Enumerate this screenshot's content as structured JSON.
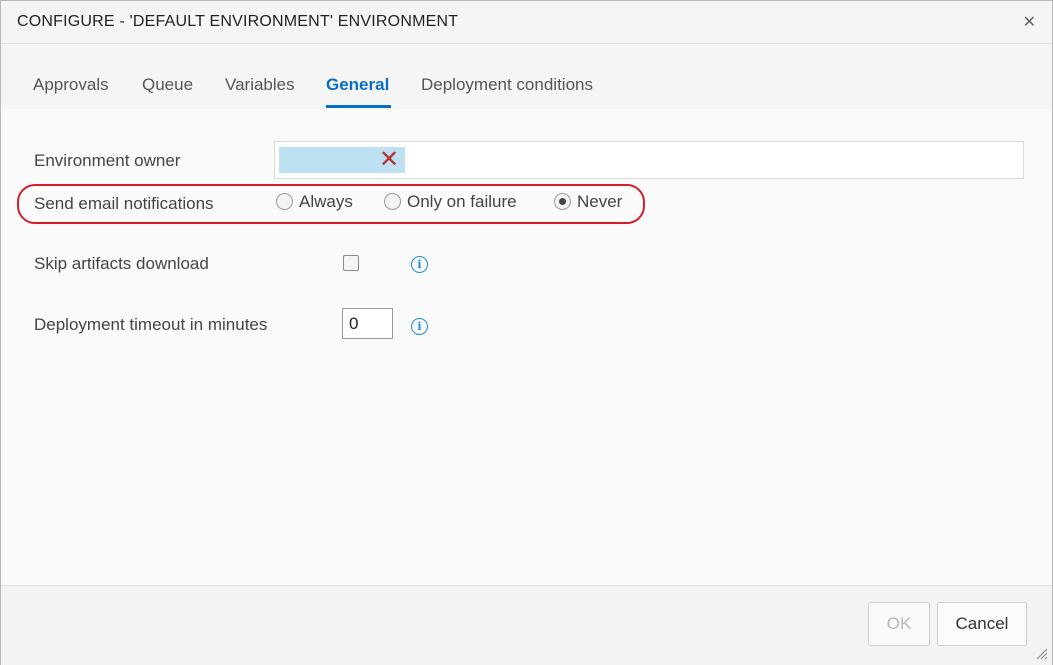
{
  "dialog": {
    "title": "CONFIGURE - 'DEFAULT ENVIRONMENT' ENVIRONMENT",
    "close_icon": "close-icon"
  },
  "tabs": [
    {
      "label": "Approvals",
      "active": false
    },
    {
      "label": "Queue",
      "active": false
    },
    {
      "label": "Variables",
      "active": false
    },
    {
      "label": "General",
      "active": true
    },
    {
      "label": "Deployment conditions",
      "active": false
    }
  ],
  "form": {
    "owner_label": "Environment owner",
    "email_label": "Send email notifications",
    "email_options": [
      {
        "label": "Always",
        "checked": false
      },
      {
        "label": "Only on failure",
        "checked": false
      },
      {
        "label": "Never",
        "checked": true
      }
    ],
    "skip_label": "Skip artifacts download",
    "skip_checked": false,
    "timeout_label": "Deployment timeout in minutes",
    "timeout_value": "0"
  },
  "footer": {
    "ok_label": "OK",
    "cancel_label": "Cancel"
  },
  "colors": {
    "accent": "#0b6ec6",
    "highlight": "#d21d2c"
  }
}
